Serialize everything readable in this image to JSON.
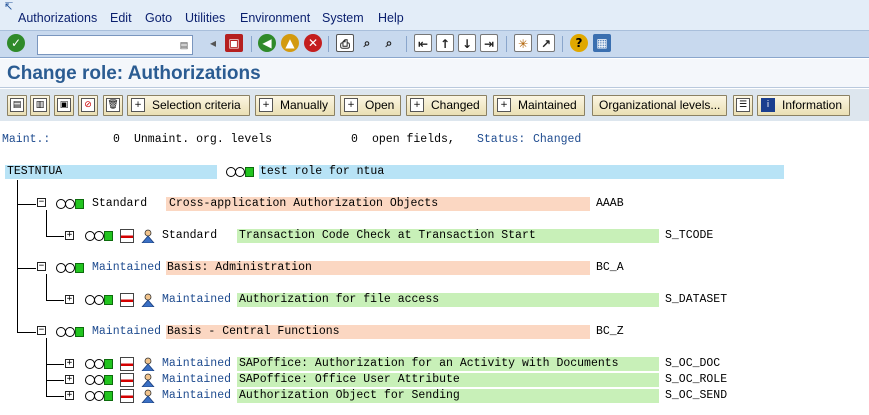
{
  "menu": {
    "items": [
      "Authorizations",
      "Edit",
      "Goto",
      "Utilities",
      "Environment",
      "System",
      "Help"
    ]
  },
  "toolbar": {
    "command_value": "",
    "icons": [
      "enter-icon",
      "back-icon",
      "save-icon",
      "back-arrow-icon",
      "exit-icon",
      "cancel-icon",
      "print-icon",
      "find-icon",
      "find-next-icon",
      "first-page-icon",
      "previous-page-icon",
      "next-page-icon",
      "last-page-icon",
      "create-session-icon",
      "shortcut-icon",
      "help-icon",
      "layout-menu-icon"
    ]
  },
  "page": {
    "title": "Change role: Authorizations"
  },
  "app_toolbar": {
    "selection_criteria": "Selection criteria",
    "manually": "Manually",
    "open": "Open",
    "changed": "Changed",
    "maintained": "Maintained",
    "org_levels": "Organizational levels...",
    "information": "Information"
  },
  "status_line": {
    "maint_label": "Maint.:",
    "maint_value": "0",
    "unmaint_label": "Unmaint. org. levels",
    "unmaint_value": "0",
    "open_fields": "open fields,",
    "status_label": "Status:",
    "status_value": "Changed"
  },
  "role": {
    "name": "TESTNTUA",
    "description": "test role for ntua"
  },
  "tree": [
    {
      "status": "Standard",
      "text": "Cross-application Authorization Objects",
      "code": "AAAB",
      "children": [
        {
          "status": "Standard",
          "text": "Transaction Code Check at Transaction Start",
          "code": "S_TCODE"
        }
      ]
    },
    {
      "status": "Maintained",
      "text": "Basis: Administration",
      "code": "BC_A",
      "children": [
        {
          "status": "Maintained",
          "text": "Authorization for file access",
          "code": "S_DATASET"
        }
      ]
    },
    {
      "status": "Maintained",
      "text": "Basis - Central Functions",
      "code": "BC_Z",
      "children": [
        {
          "status": "Maintained",
          "text": "SAPoffice: Authorization for an Activity with Documents",
          "code": "S_OC_DOC"
        },
        {
          "status": "Maintained",
          "text": "SAPoffice: Office User Attribute",
          "code": "S_OC_ROLE"
        },
        {
          "status": "Maintained",
          "text": "Authorization Object for Sending",
          "code": "S_OC_SEND"
        }
      ]
    }
  ],
  "colors": {
    "title": "#2b5c92",
    "maintained": "#1e4b8f",
    "class_highlight": "#fbd7c2",
    "object_highlight": "#c8f0b8",
    "role_highlight": "#b8e3f6"
  }
}
